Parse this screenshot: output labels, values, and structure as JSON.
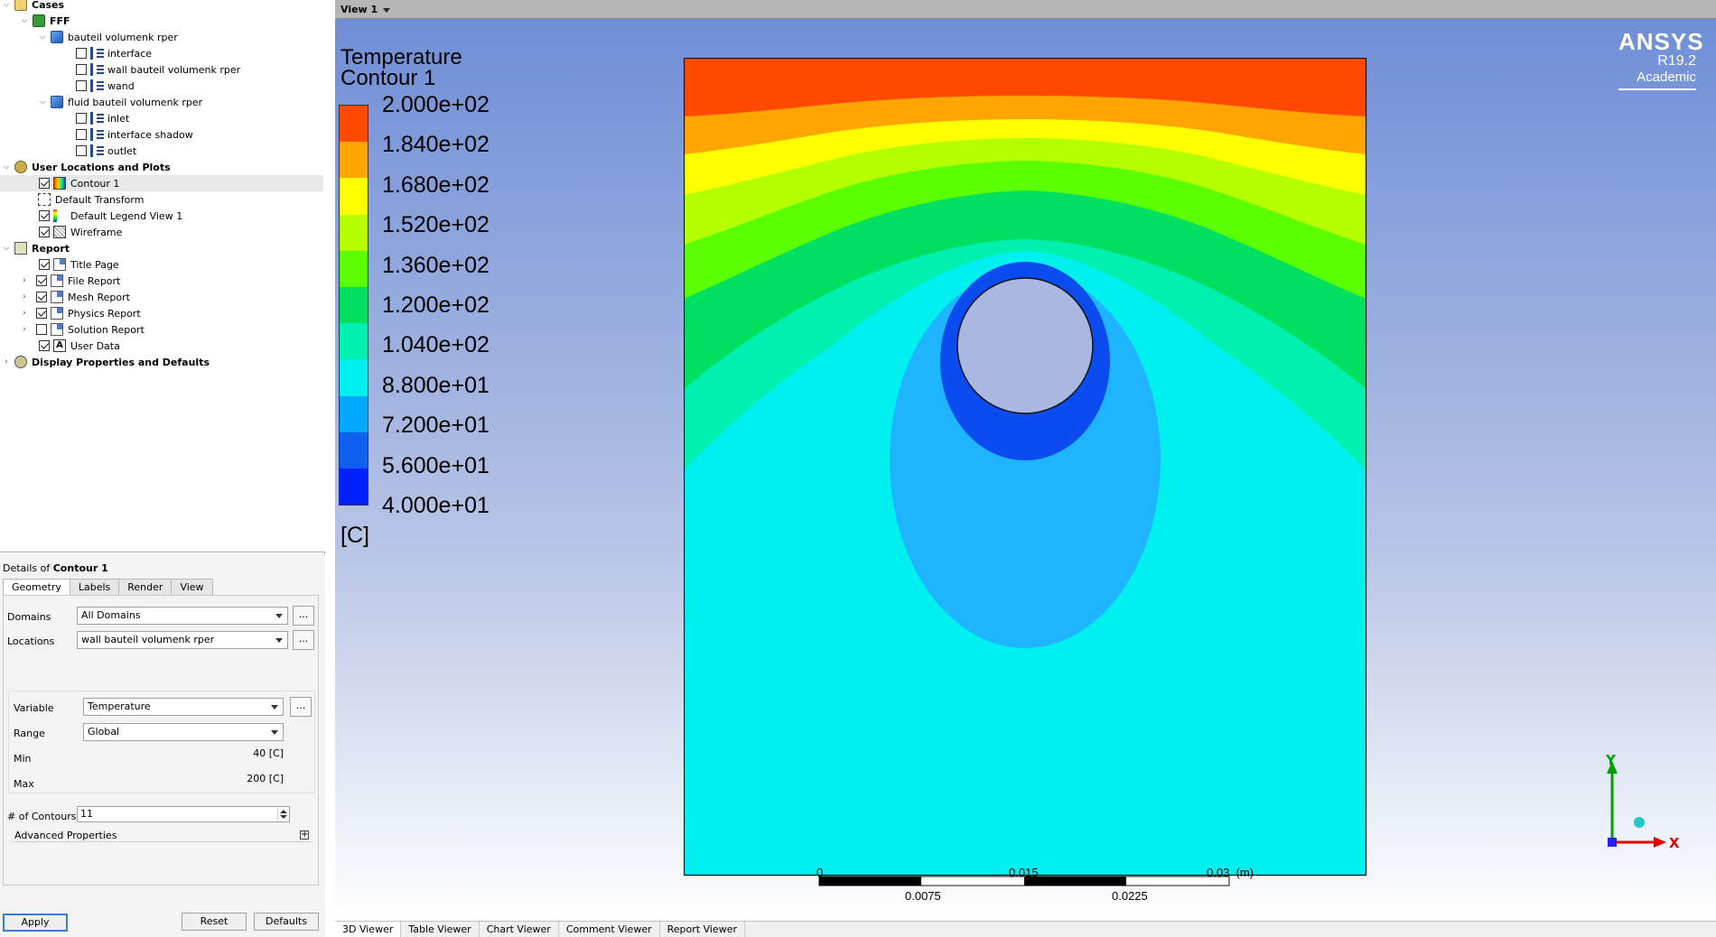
{
  "tree": {
    "cases": "Cases",
    "fff": "FFF",
    "domain1": "bauteil volumenk rper",
    "interface": "interface",
    "wall": "wall bauteil volumenk rper",
    "wand": "wand",
    "domain2": "fluid bauteil volumenk rper",
    "inlet": "inlet",
    "interface_shadow": "interface shadow",
    "outlet": "outlet",
    "user_locations": "User Locations and Plots",
    "contour1": "Contour 1",
    "default_transform": "Default Transform",
    "default_legend": "Default Legend View 1",
    "wireframe": "Wireframe",
    "report": "Report",
    "title_page": "Title Page",
    "file_report": "File Report",
    "mesh_report": "Mesh Report",
    "physics_report": "Physics Report",
    "solution_report": "Solution Report",
    "user_data": "User Data",
    "display_props": "Display Properties and Defaults"
  },
  "details": {
    "title_prefix": "Details of",
    "title_obj": "Contour 1",
    "tabs": [
      "Geometry",
      "Labels",
      "Render",
      "View"
    ],
    "domains_label": "Domains",
    "domains_value": "All Domains",
    "locations_label": "Locations",
    "locations_value": "wall bauteil volumenk rper",
    "variable_label": "Variable",
    "variable_value": "Temperature",
    "range_label": "Range",
    "range_value": "Global",
    "min_label": "Min",
    "min_value": "40 [C]",
    "max_label": "Max",
    "max_value": "200 [C]",
    "contours_label": "# of Contours",
    "contours_value": "11",
    "advanced": "Advanced Properties",
    "dots": "...",
    "apply": "Apply",
    "reset": "Reset",
    "defaults": "Defaults"
  },
  "viewer": {
    "view_label": "View 1",
    "legend_title1": "Temperature",
    "legend_title2": "Contour 1",
    "legend_values": [
      "2.000e+02",
      "1.840e+02",
      "1.680e+02",
      "1.520e+02",
      "1.360e+02",
      "1.200e+02",
      "1.040e+02",
      "8.800e+01",
      "7.200e+01",
      "5.600e+01",
      "4.000e+01"
    ],
    "legend_colors": [
      "#ff4a00",
      "#ffa600",
      "#ffff00",
      "#b4ff00",
      "#5aff00",
      "#00e060",
      "#00f0b0",
      "#00f0f0",
      "#00a8ff",
      "#1060f0",
      "#0020ff"
    ],
    "legend_unit": "[C]",
    "logo_name": "ANSYS",
    "logo_version": "R19.2",
    "logo_edition": "Academic",
    "scale_top": [
      "0",
      "0.015",
      "0.03  (m)"
    ],
    "scale_bottom": [
      "0.0075",
      "0.0225"
    ],
    "axis_y": "Y",
    "axis_x": "X"
  },
  "bottom_tabs": [
    "3D Viewer",
    "Table Viewer",
    "Chart Viewer",
    "Comment Viewer",
    "Report Viewer"
  ]
}
